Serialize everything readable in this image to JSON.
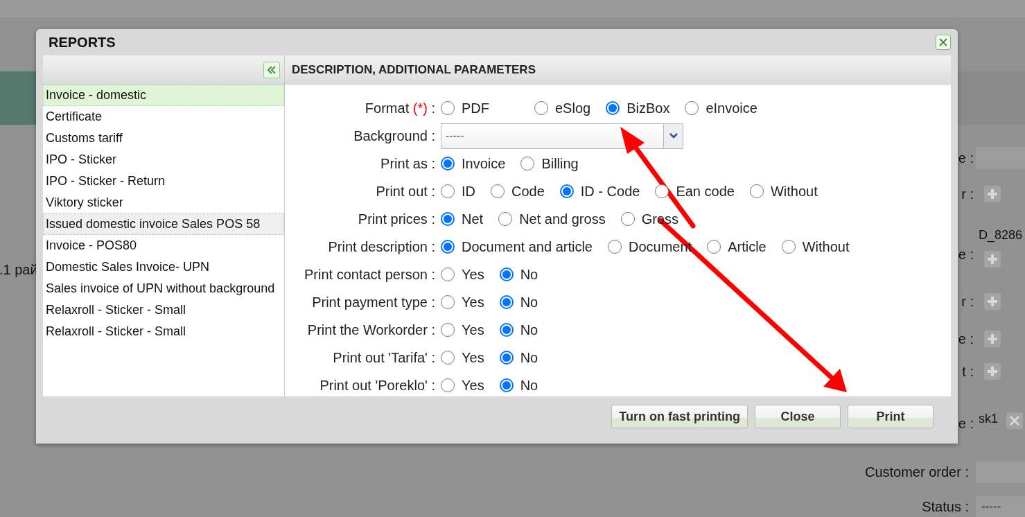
{
  "background_page": {
    "left_text": ".1 рай",
    "rows": [
      {
        "kind": "field",
        "label": "e :"
      },
      {
        "kind": "add",
        "label": "r :"
      },
      {
        "kind": "value_add",
        "label": "e :",
        "value": "D_8286"
      },
      {
        "kind": "add",
        "label": "r :"
      },
      {
        "kind": "add",
        "label": "e :"
      },
      {
        "kind": "add",
        "label": "t :"
      },
      {
        "kind": "value_remove",
        "label": "e :",
        "value": "sk1"
      },
      {
        "kind": "field",
        "label": "Customer order :"
      },
      {
        "kind": "field",
        "label": "Status :",
        "value": "-----"
      }
    ]
  },
  "dialog": {
    "title": "REPORTS",
    "reports": [
      {
        "label": "Invoice - domestic",
        "selected": true,
        "hovered": false
      },
      {
        "label": "Certificate",
        "selected": false,
        "hovered": false
      },
      {
        "label": "Customs tariff",
        "selected": false,
        "hovered": false
      },
      {
        "label": "IPO - Sticker",
        "selected": false,
        "hovered": false
      },
      {
        "label": "IPO - Sticker - Return",
        "selected": false,
        "hovered": false
      },
      {
        "label": "Viktory sticker",
        "selected": false,
        "hovered": false
      },
      {
        "label": "Issued domestic invoice Sales POS 58",
        "selected": false,
        "hovered": true
      },
      {
        "label": "Invoice - POS80",
        "selected": false,
        "hovered": false
      },
      {
        "label": "Domestic Sales Invoice- UPN",
        "selected": false,
        "hovered": false
      },
      {
        "label": "Sales invoice of UPN without background",
        "selected": false,
        "hovered": false
      },
      {
        "label": "Relaxroll - Sticker - Small",
        "selected": false,
        "hovered": false
      },
      {
        "label": "Relaxroll - Sticker - Small",
        "selected": false,
        "hovered": false
      }
    ],
    "panel_title": "DESCRIPTION, ADDITIONAL PARAMETERS",
    "parameters": [
      {
        "kind": "radio",
        "label": "Format",
        "required_mark": "(*)",
        "colon": ":",
        "options": [
          {
            "label": "PDF",
            "selected": false
          },
          {
            "label": "eSlog",
            "selected": false
          },
          {
            "label": "BizBox",
            "selected": true
          },
          {
            "label": "eInvoice",
            "selected": false
          }
        ]
      },
      {
        "kind": "select",
        "label": "Background :",
        "value": "-----"
      },
      {
        "kind": "radio",
        "label": "Print as :",
        "options": [
          {
            "label": "Invoice",
            "selected": true
          },
          {
            "label": "Billing",
            "selected": false
          }
        ]
      },
      {
        "kind": "radio",
        "label": "Print out :",
        "options": [
          {
            "label": "ID",
            "selected": false
          },
          {
            "label": "Code",
            "selected": false
          },
          {
            "label": "ID - Code",
            "selected": true
          },
          {
            "label": "Ean code",
            "selected": false
          },
          {
            "label": "Without",
            "selected": false
          }
        ]
      },
      {
        "kind": "radio",
        "label": "Print prices :",
        "options": [
          {
            "label": "Net",
            "selected": true
          },
          {
            "label": "Net and gross",
            "selected": false
          },
          {
            "label": "Gross",
            "selected": false
          }
        ]
      },
      {
        "kind": "radio",
        "label": "Print description :",
        "options": [
          {
            "label": "Document and article",
            "selected": true
          },
          {
            "label": "Document",
            "selected": false
          },
          {
            "label": "Article",
            "selected": false
          },
          {
            "label": "Without",
            "selected": false
          }
        ]
      },
      {
        "kind": "radio",
        "label": "Print contact person :",
        "options": [
          {
            "label": "Yes",
            "selected": false
          },
          {
            "label": "No",
            "selected": true
          }
        ]
      },
      {
        "kind": "radio",
        "label": "Print payment type :",
        "options": [
          {
            "label": "Yes",
            "selected": false
          },
          {
            "label": "No",
            "selected": true
          }
        ]
      },
      {
        "kind": "radio",
        "label": "Print the Workorder :",
        "options": [
          {
            "label": "Yes",
            "selected": false
          },
          {
            "label": "No",
            "selected": true
          }
        ]
      },
      {
        "kind": "radio",
        "label": "Print out 'Tarifa' :",
        "options": [
          {
            "label": "Yes",
            "selected": false
          },
          {
            "label": "No",
            "selected": true
          }
        ]
      },
      {
        "kind": "radio",
        "label": "Print out 'Poreklo' :",
        "options": [
          {
            "label": "Yes",
            "selected": false
          },
          {
            "label": "No",
            "selected": true
          }
        ]
      }
    ],
    "buttons": [
      "Turn on fast printing",
      "Close",
      "Print"
    ]
  }
}
